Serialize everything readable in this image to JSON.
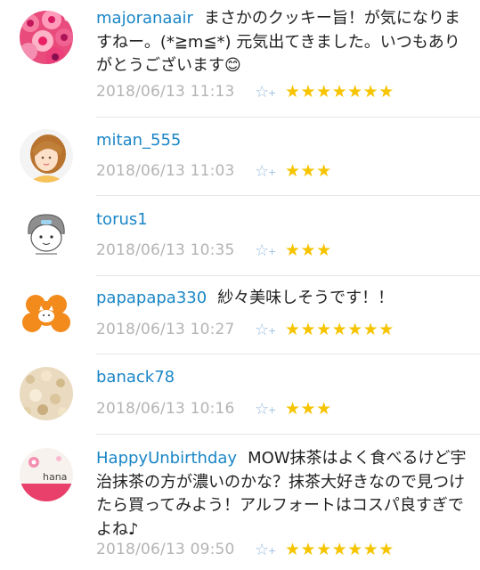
{
  "comments": [
    {
      "user": "majoranaair",
      "text": "まさかのクッキー旨！が気になりますねー。(*≧m≦*) 元気出てきました。いつもありがとうございます😊",
      "date": "2018/06/13 11:13",
      "add_star_icon": "☆",
      "add_star_plus": "+",
      "stars": "★★★★★★★",
      "star_count": 7,
      "avatar_icon": "pink-flowers-icon"
    },
    {
      "user": "mitan_555",
      "text": "",
      "date": "2018/06/13 11:03",
      "add_star_icon": "☆",
      "add_star_plus": "+",
      "stars": "★★★",
      "star_count": 3,
      "avatar_icon": "girl-portrait-icon"
    },
    {
      "user": "torus1",
      "text": "",
      "date": "2018/06/13 10:35",
      "add_star_icon": "☆",
      "add_star_plus": "+",
      "stars": "★★★",
      "star_count": 3,
      "avatar_icon": "sketch-character-icon"
    },
    {
      "user": "papapapa330",
      "text": "紗々美味しそうです！！",
      "date": "2018/06/13 10:27",
      "add_star_icon": "☆",
      "add_star_plus": "+",
      "stars": "★★★★★★★",
      "star_count": 7,
      "avatar_icon": "orange-cat-icon"
    },
    {
      "user": "banack78",
      "text": "",
      "date": "2018/06/13 10:16",
      "add_star_icon": "☆",
      "add_star_plus": "+",
      "stars": "★★★",
      "star_count": 3,
      "avatar_icon": "bread-icon"
    },
    {
      "user": "HappyUnbirthday",
      "text": "MOW抹茶はよく食べるけど宇治抹茶の方が濃いのかな？抹茶大好きなので見つけたら買ってみよう！アルフォートはコスパ良すぎでよね♪",
      "date": "2018/06/13 09:50",
      "add_star_icon": "☆",
      "add_star_plus": "+",
      "stars": "★★★★★★★",
      "star_count": 7,
      "avatar_icon": "hana-cake-icon",
      "avatar_label": "hana"
    }
  ],
  "colors": {
    "username": "#1a86c7",
    "date": "#b4b4b4",
    "star": "#f6c400",
    "add_star": "#9dbfe0"
  }
}
